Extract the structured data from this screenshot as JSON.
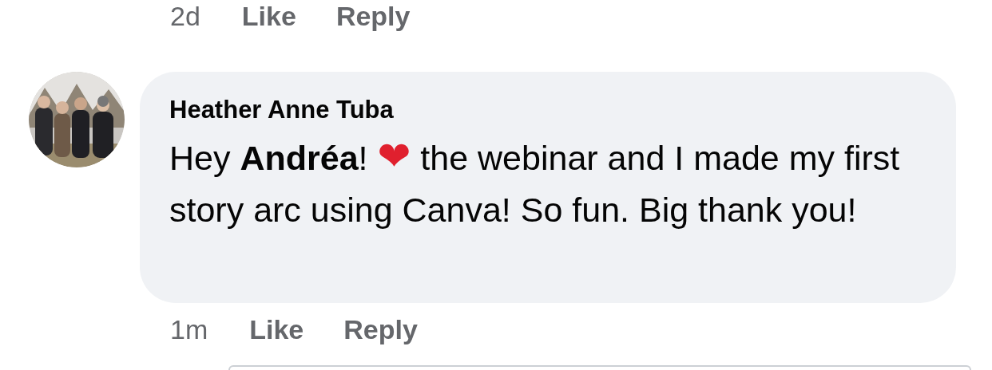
{
  "previous_comment": {
    "time": "2d",
    "actions": [
      "Like",
      "Reply"
    ]
  },
  "comment": {
    "author": "Heather Anne Tuba",
    "text_before": "Hey **Andréa**!",
    "emoji": "❤",
    "text_after": "the webinar and I made my first story arc using Canva! So fun. Big thank you!",
    "time": "1m",
    "actions": [
      "Like",
      "Reply"
    ]
  }
}
